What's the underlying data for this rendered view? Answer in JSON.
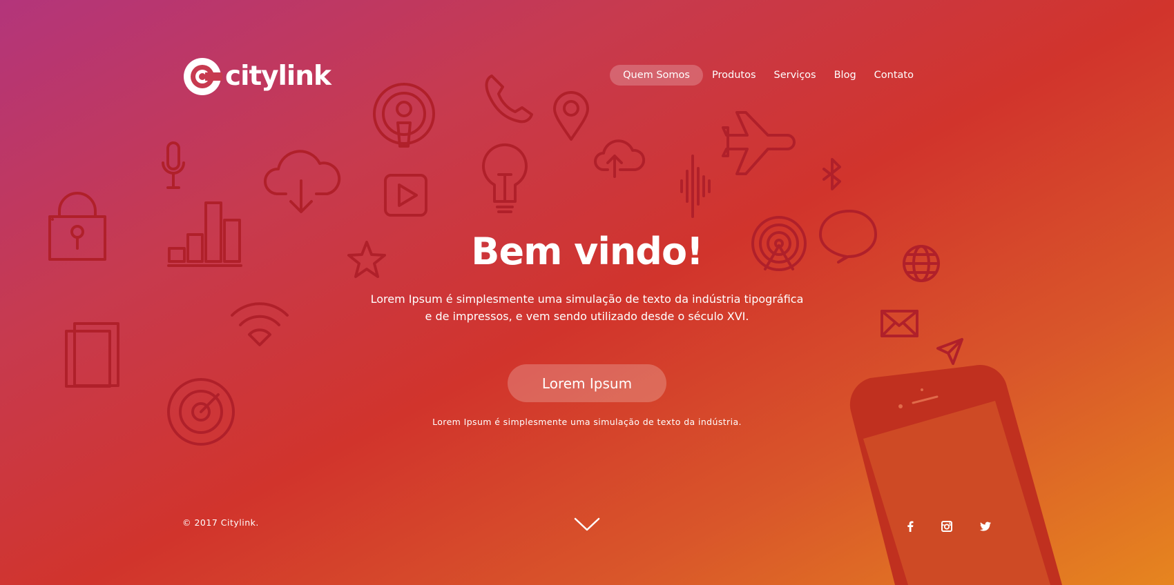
{
  "brand": {
    "name": "citylink"
  },
  "nav": {
    "items": [
      {
        "label": "Quem Somos",
        "active": true
      },
      {
        "label": "Produtos",
        "active": false
      },
      {
        "label": "Serviços",
        "active": false
      },
      {
        "label": "Blog",
        "active": false
      },
      {
        "label": "Contato",
        "active": false
      }
    ]
  },
  "hero": {
    "title": "Bem vindo!",
    "text_line1": "Lorem Ipsum é simplesmente uma simulação de texto da indústria tipográfica",
    "text_line2": "e de impressos, e vem sendo utilizado desde o século XVI.",
    "cta_label": "Lorem Ipsum",
    "small_text": "Lorem Ipsum é simplesmente uma simulação de texto da indústria."
  },
  "footer": {
    "copyright": "© 2017 Citylink.",
    "scroll_icon": "chevron-down-icon",
    "social": [
      "facebook-icon",
      "instagram-icon",
      "twitter-icon"
    ]
  },
  "colors": {
    "gradient_start": "#b3357b",
    "gradient_mid": "#d1342c",
    "gradient_end": "#e6851f",
    "icon_stroke": "#b0202a",
    "text": "#ffffff"
  },
  "decorative_icons": [
    "lock-icon",
    "microphone-icon",
    "bar-chart-icon",
    "cloud-download-icon",
    "podcast-icon",
    "play-icon",
    "lightbulb-icon",
    "phone-icon",
    "location-pin-icon",
    "cloud-upload-icon",
    "sound-wave-icon",
    "airplane-icon",
    "bluetooth-icon",
    "broadcast-icon",
    "chat-bubble-icon",
    "globe-icon",
    "mail-icon",
    "paper-plane-icon",
    "star-icon",
    "wifi-icon",
    "documents-icon",
    "target-icon",
    "smartphone-illustration"
  ]
}
